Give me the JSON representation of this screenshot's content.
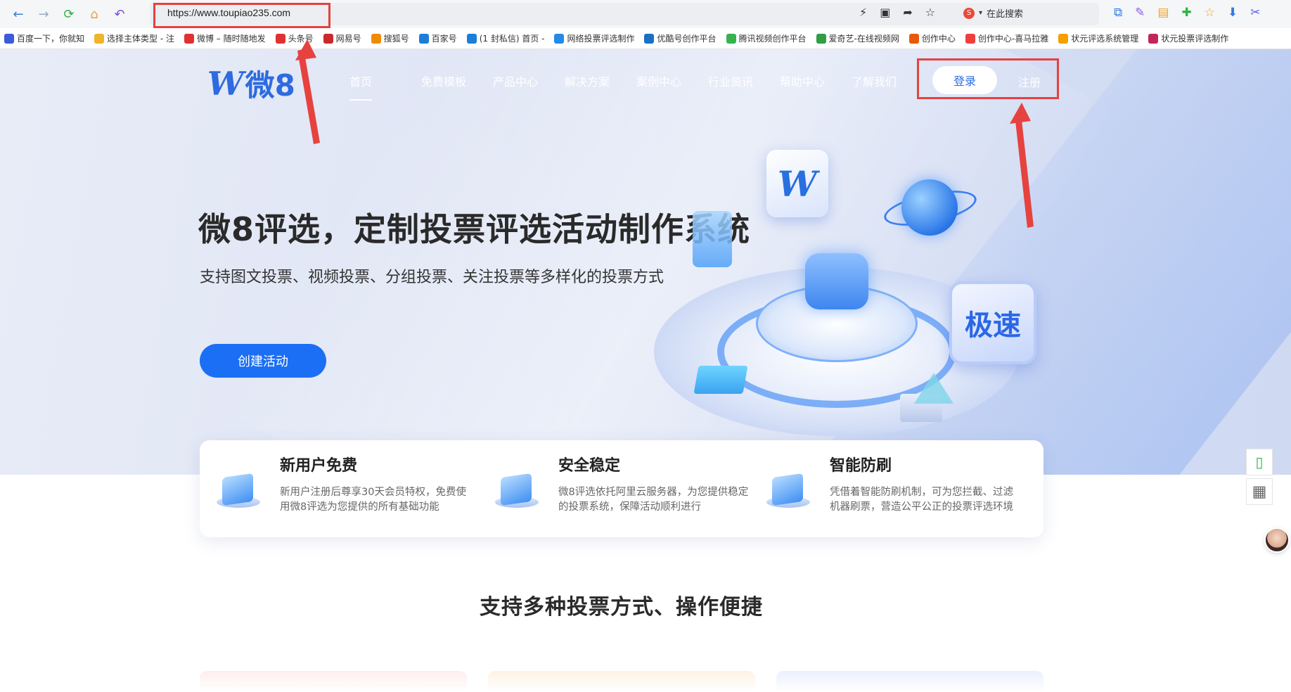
{
  "browser": {
    "url": "https://www.toupiao235.com",
    "search_placeholder": "在此搜索",
    "bookmarks": [
      {
        "label": "百度一下，你就知",
        "color": "#3b5bdb"
      },
      {
        "label": "选择主体类型 - 注",
        "color": "#f0b429"
      },
      {
        "label": "微博 – 随时随地发",
        "color": "#e03131"
      },
      {
        "label": "头条号",
        "color": "#e03131"
      },
      {
        "label": "网易号",
        "color": "#c92a2a"
      },
      {
        "label": "搜狐号",
        "color": "#f08c00"
      },
      {
        "label": "百家号",
        "color": "#1c7ed6"
      },
      {
        "label": "(1 封私信) 首页 -",
        "color": "#1c7ed6"
      },
      {
        "label": "网络投票评选制作",
        "color": "#228be6"
      },
      {
        "label": "优酷号创作平台",
        "color": "#1971c2"
      },
      {
        "label": "腾讯视频创作平台",
        "color": "#37b24d"
      },
      {
        "label": "爱奇艺-在线视频网",
        "color": "#2f9e44"
      },
      {
        "label": "创作中心",
        "color": "#e8590c"
      },
      {
        "label": "创作中心-喜马拉雅",
        "color": "#f03e3e"
      },
      {
        "label": "状元评选系统管理",
        "color": "#f59f00"
      },
      {
        "label": "状元投票评选制作",
        "color": "#c2255c"
      }
    ]
  },
  "site": {
    "logo_letter": "W",
    "logo_text": "微8",
    "nav": [
      "首页",
      "免费模板",
      "产品中心",
      "解决方案",
      "案例中心",
      "行业资讯",
      "帮助中心",
      "了解我们"
    ],
    "login": "登录",
    "register": "注册",
    "headline": "微8评选，定制投票评选活动制作系统",
    "subline": "支持图文投票、视频投票、分组投票、关注投票等多样化的投票方式",
    "cta": "创建活动",
    "speed_label": "极速",
    "features": [
      {
        "title": "新用户免费",
        "desc": "新用户注册后尊享30天会员特权，免费使用微8评选为您提供的所有基础功能"
      },
      {
        "title": "安全稳定",
        "desc": "微8评选依托阿里云服务器，为您提供稳定的投票系统，保障活动顺利进行"
      },
      {
        "title": "智能防刷",
        "desc": "凭借着智能防刷机制，可为您拦截、过滤机器刷票，营造公平公正的投票评选环境"
      }
    ],
    "section_title": "支持多种投票方式、操作便捷"
  },
  "colors": {
    "accent": "#1b6ff5",
    "highlight": "#e6423f",
    "brand": "#2e6be0"
  }
}
